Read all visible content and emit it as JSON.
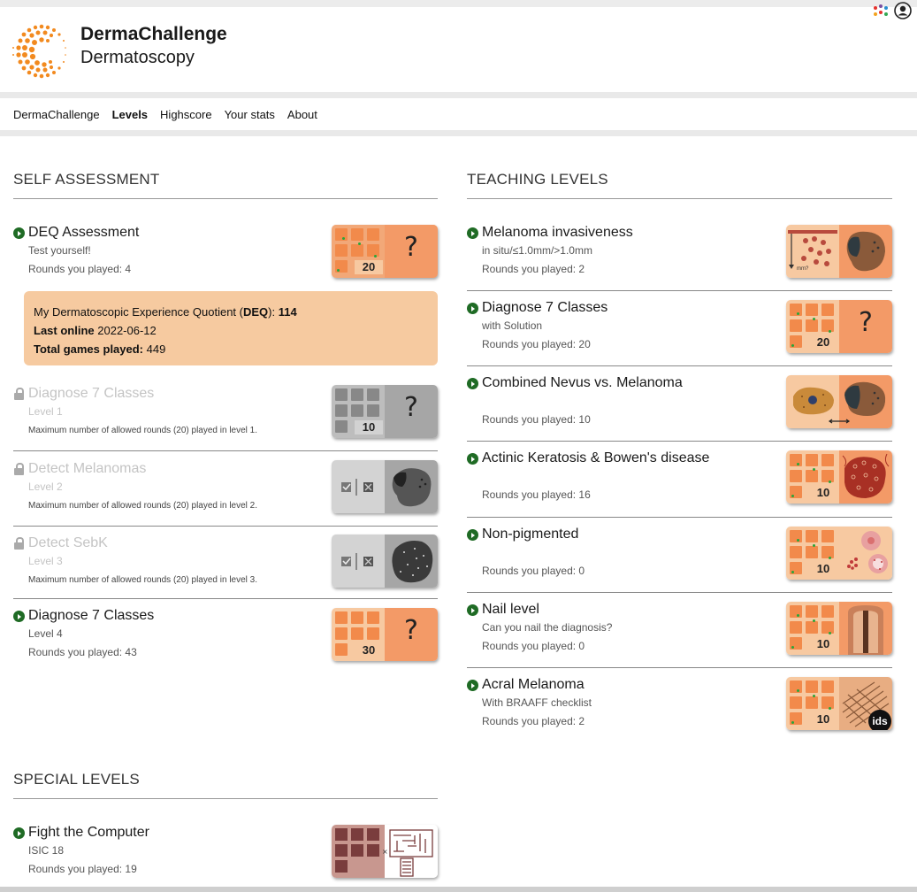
{
  "header": {
    "brand_title": "DermaChallenge",
    "brand_subtitle": "Dermatoscopy"
  },
  "nav": {
    "items": [
      "DermaChallenge",
      "Levels",
      "Highscore",
      "Your stats",
      "About"
    ],
    "active": "Levels"
  },
  "self_assessment": {
    "title": "SELF ASSESSMENT",
    "deq": {
      "name": "DEQ Assessment",
      "sub": "Test yourself!",
      "rounds": "Rounds you played: 4",
      "thumb_number": "20"
    },
    "deq_box": {
      "quotient_label": "My Dermatoscopic Experience Quotient (",
      "quotient_abbr": "DEQ",
      "quotient_close": "): ",
      "quotient_value": "114",
      "last_online_label": "Last online",
      "last_online_value": "2022-06-12",
      "total_games_label": "Total games played:",
      "total_games_value": "449"
    },
    "levels": [
      {
        "name": "Diagnose 7 Classes",
        "sub": "Level 1",
        "note": "Maximum number of allowed rounds (20) played in level 1.",
        "thumb_number": "10",
        "locked": true
      },
      {
        "name": "Detect Melanomas",
        "sub": "Level 2",
        "note": "Maximum number of allowed rounds (20) played in level 2.",
        "locked": true
      },
      {
        "name": "Detect SebK",
        "sub": "Level 3",
        "note": "Maximum number of allowed rounds (20) played in level 3.",
        "locked": true
      },
      {
        "name": "Diagnose 7 Classes",
        "sub": "Level 4",
        "rounds": "Rounds you played: 43",
        "thumb_number": "30",
        "locked": false
      }
    ]
  },
  "special_levels": {
    "title": "SPECIAL LEVELS",
    "levels": [
      {
        "name": "Fight the Computer",
        "sub": "ISIC 18",
        "rounds": "Rounds you played: 19"
      }
    ]
  },
  "teaching_levels": {
    "title": "TEACHING LEVELS",
    "levels": [
      {
        "name": "Melanoma invasiveness",
        "sub": "in situ/≤1.0mm/>1.0mm",
        "rounds": "Rounds you played: 2",
        "thumb_label": "mm?"
      },
      {
        "name": "Diagnose 7 Classes",
        "sub": "with Solution",
        "rounds": "Rounds you played: 20",
        "thumb_number": "20"
      },
      {
        "name": "Combined Nevus vs. Melanoma",
        "sub": "",
        "rounds": "Rounds you played: 10"
      },
      {
        "name": "Actinic Keratosis & Bowen's disease",
        "sub": "",
        "rounds": "Rounds you played: 16",
        "thumb_number": "10"
      },
      {
        "name": "Non-pigmented",
        "sub": "",
        "rounds": "Rounds you played: 0",
        "thumb_number": "10"
      },
      {
        "name": "Nail level",
        "sub": "Can you nail the diagnosis?",
        "rounds": "Rounds you played: 0",
        "thumb_number": "10"
      },
      {
        "name": "Acral Melanoma",
        "sub": "With BRAAFF checklist",
        "rounds": "Rounds you played: 2",
        "thumb_number": "10",
        "badge": "ids"
      }
    ]
  },
  "colors": {
    "accent_orange": "#f28a4b",
    "tile_orange": "#f2a878",
    "tile_peach": "#f7c9a1",
    "locked_gray": "#bdbdbd",
    "play_green": "#1f6b25",
    "deq_box": "#f6caa0",
    "maroon": "#7a3d3d"
  },
  "icons": [
    "logo-icon",
    "apps-dots-icon",
    "user-icon",
    "play-icon",
    "lock-icon"
  ]
}
